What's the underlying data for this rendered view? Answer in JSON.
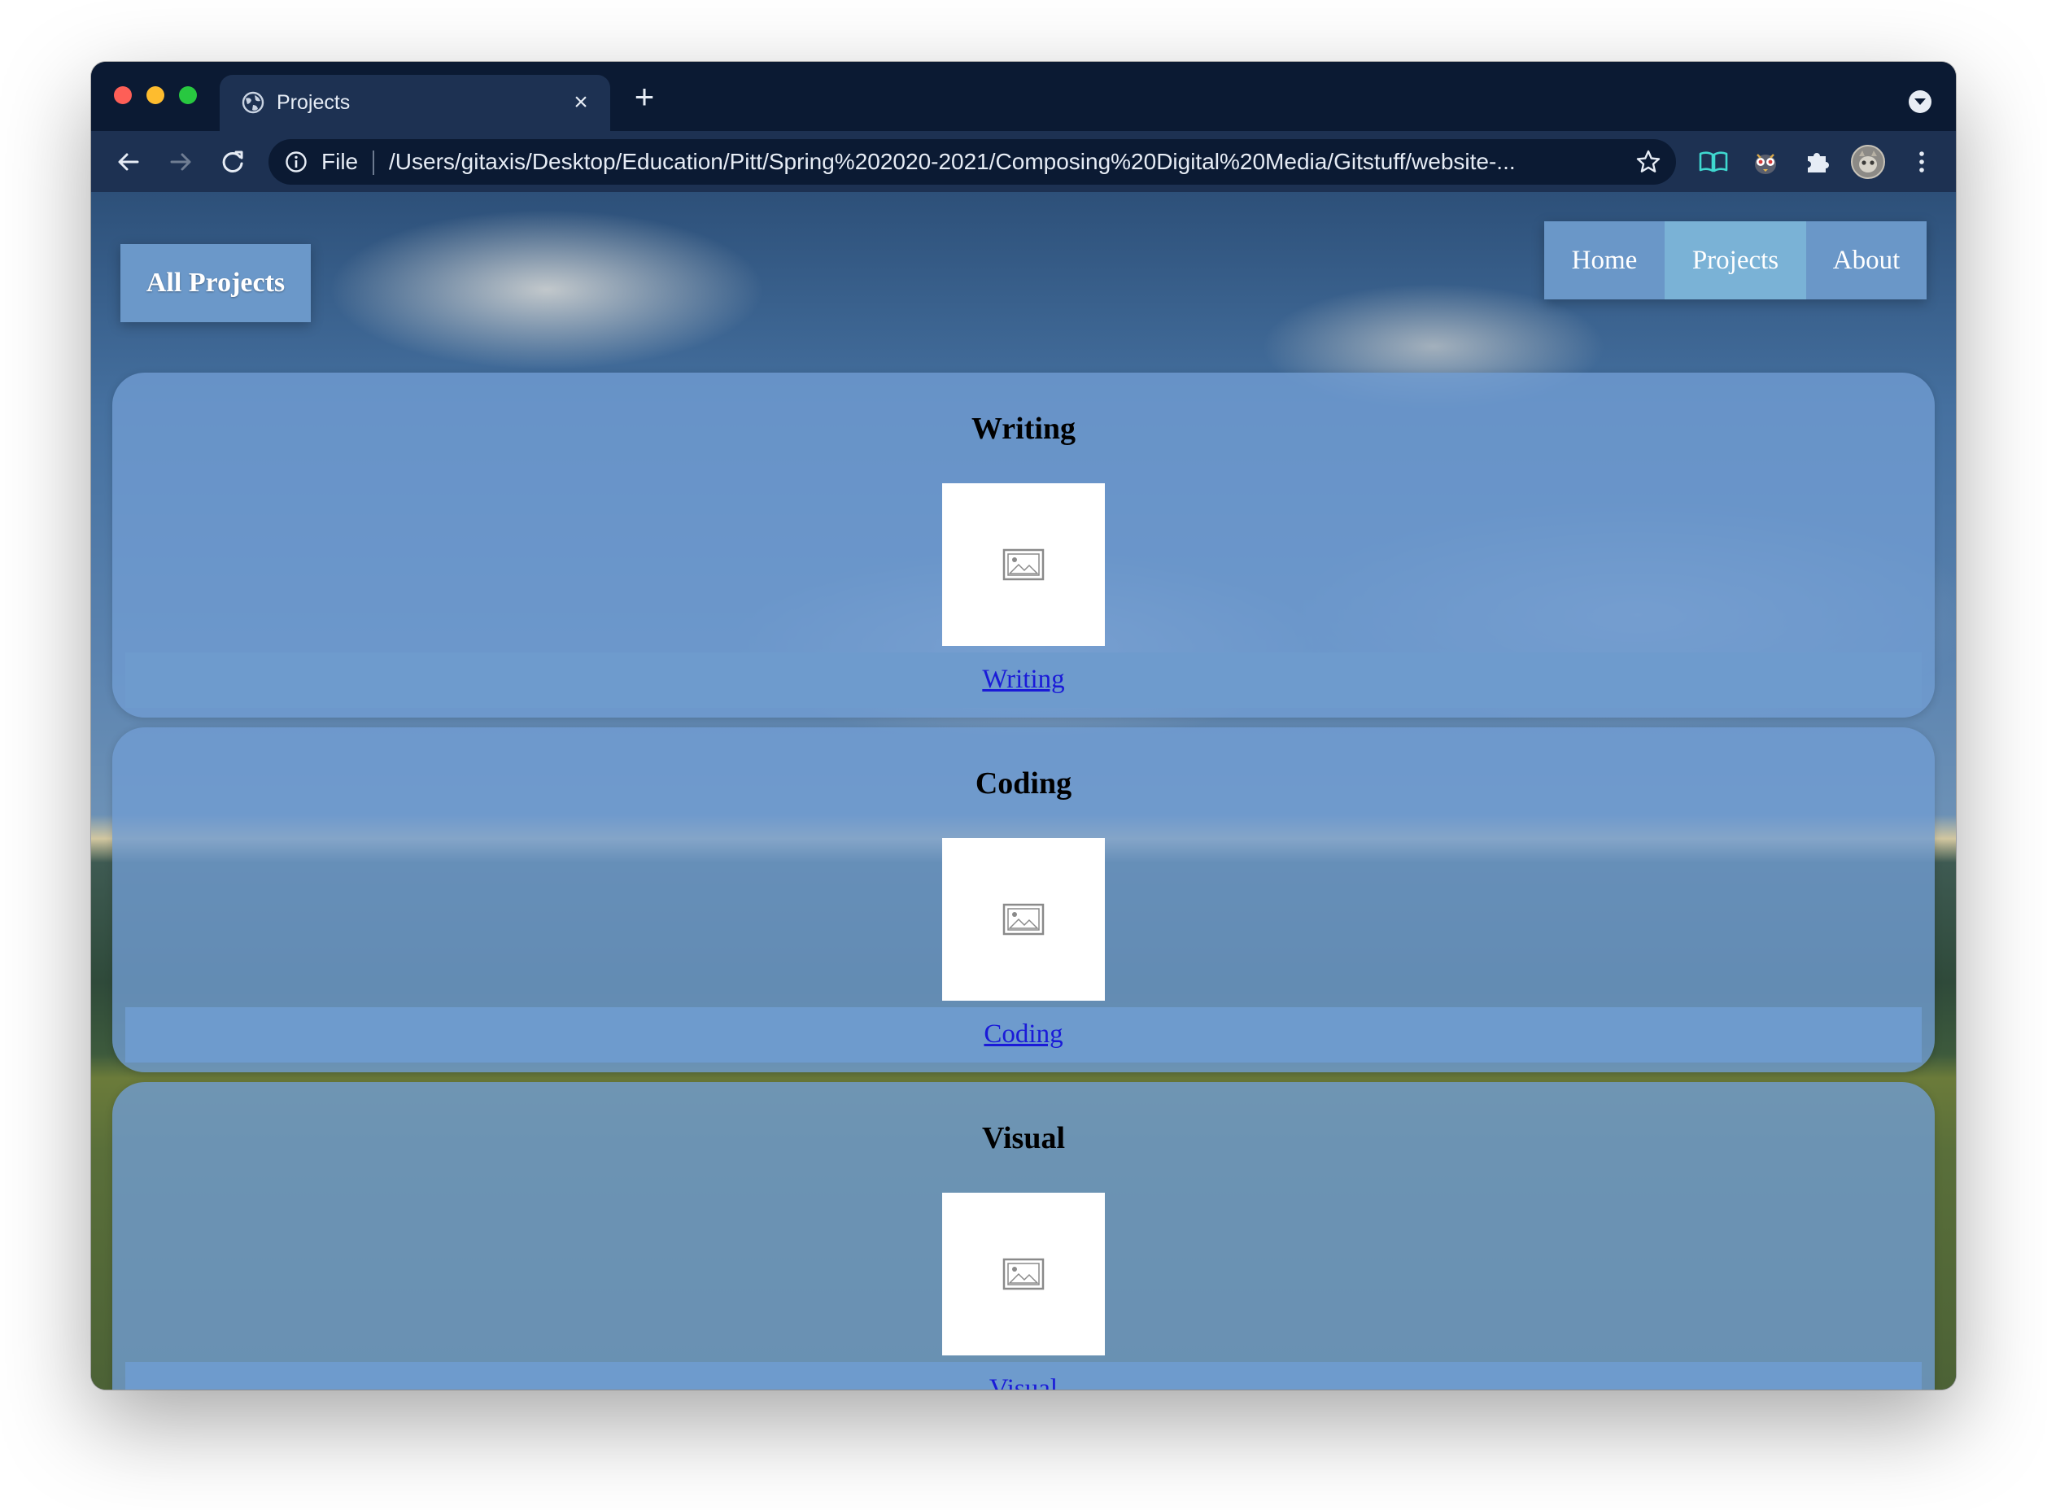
{
  "browser": {
    "tab": {
      "title": "Projects",
      "close_glyph": "×"
    },
    "new_tab_glyph": "+",
    "address_bar": {
      "scheme_label": "File",
      "url": "/Users/gitaxis/Desktop/Education/Pitt/Spring%202020-2021/Composing%20Digital%20Media/Gitstuff/website-..."
    },
    "icons": {
      "tab_favicon": "globe-icon",
      "back": "arrow-left-icon",
      "forward": "arrow-right-icon",
      "reload": "reload-icon",
      "info": "info-icon",
      "bookmark": "star-icon",
      "extensions": [
        "book-icon",
        "owl-icon",
        "puzzle-icon",
        "avatar-icon",
        "kebab-menu-icon"
      ],
      "profile": "chevron-down-icon"
    },
    "colors": {
      "frame": "#0b1a33",
      "toolbar": "#1d3152",
      "text": "#e6ecf5"
    }
  },
  "page": {
    "brand": "All Projects",
    "nav": {
      "items": [
        {
          "label": "Home",
          "active": false
        },
        {
          "label": "Projects",
          "active": true
        },
        {
          "label": "About",
          "active": false
        }
      ]
    },
    "projects": [
      {
        "title": "Writing",
        "link_text": "Writing",
        "image_icon": "broken-image-icon"
      },
      {
        "title": "Coding",
        "link_text": "Coding",
        "image_icon": "broken-image-icon"
      },
      {
        "title": "Visual",
        "link_text": "Visual",
        "image_icon": "broken-image-icon"
      }
    ],
    "colors": {
      "card": "#709cd2",
      "nav": "#6a97c8",
      "nav_active": "#7ab2d6",
      "link": "#1a1ad8"
    }
  }
}
